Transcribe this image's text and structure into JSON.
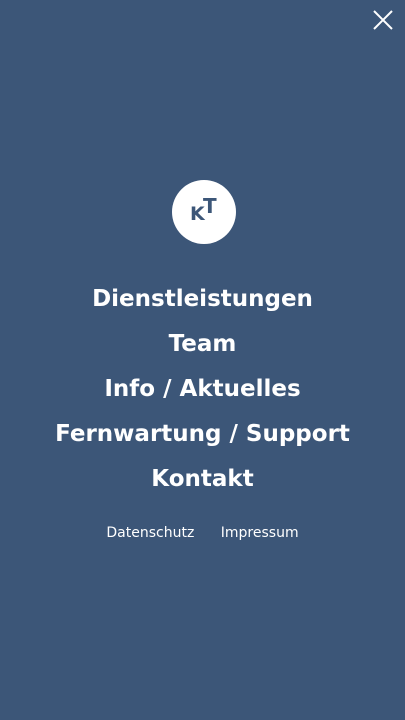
{
  "theme": {
    "background": "#3c5678",
    "foreground": "#ffffff"
  },
  "header": {
    "close_icon": "close-icon"
  },
  "logo": {
    "letters": [
      "K",
      "T"
    ]
  },
  "menu": {
    "items": [
      {
        "label": "Dienstleistungen"
      },
      {
        "label": "Team"
      },
      {
        "label": "Info / Aktuelles"
      },
      {
        "label": "Fernwartung / Support"
      },
      {
        "label": "Kontakt"
      }
    ]
  },
  "legal": {
    "links": [
      {
        "label": "Datenschutz"
      },
      {
        "label": "Impressum"
      }
    ]
  }
}
